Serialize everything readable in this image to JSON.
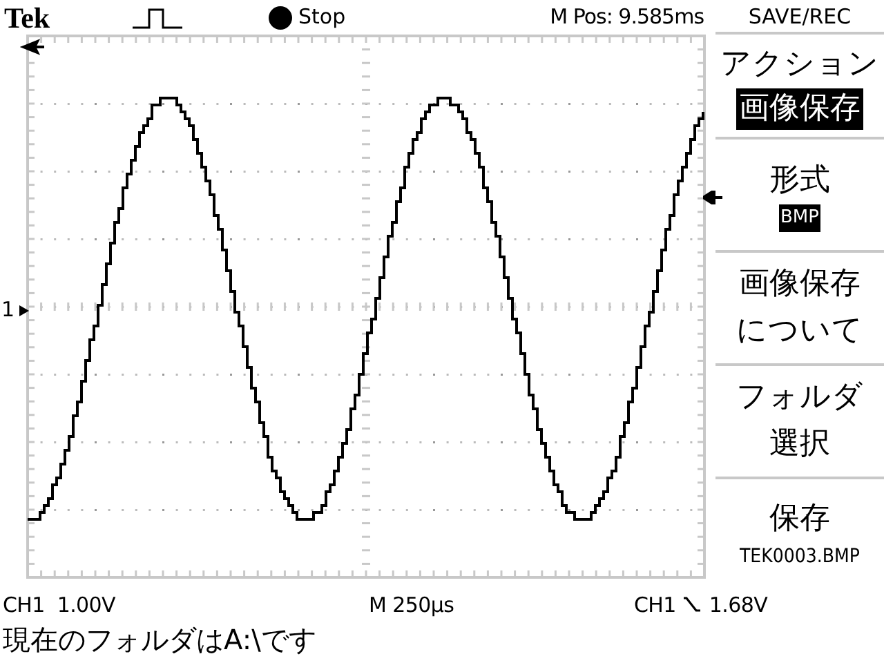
{
  "header": {
    "logo": "Tek",
    "run_state": "Stop",
    "position": "M Pos: 9.585ms"
  },
  "scope": {
    "ch1_marker": "1"
  },
  "menu": {
    "title": "SAVE/REC",
    "items": [
      {
        "kind": "action",
        "lines": [
          "アクション"
        ],
        "value": "画像保存",
        "highlighted": true
      },
      {
        "kind": "option",
        "lines": [
          "形式"
        ],
        "value": "BMP",
        "highlighted": true
      },
      {
        "kind": "button",
        "lines": [
          "画像保存",
          "について"
        ]
      },
      {
        "kind": "button",
        "lines": [
          "フォルダ",
          "選択"
        ]
      },
      {
        "kind": "save",
        "lines": [
          "保存"
        ],
        "value": "TEK0003.BMP",
        "highlighted": false
      }
    ]
  },
  "status": {
    "channel_scale": "CH1  1.00V",
    "timebase": "M 250µs",
    "trigger_source": "CH1",
    "trigger_level": "1.68V"
  },
  "message": "現在のフォルダはA:\\です"
}
